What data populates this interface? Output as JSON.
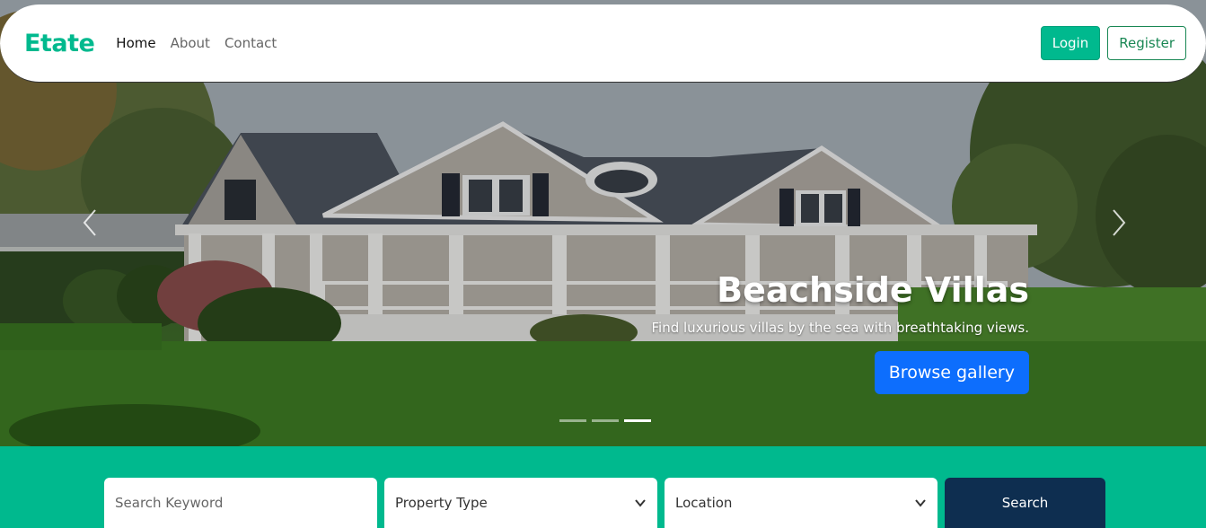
{
  "navbar": {
    "brand": "Etate",
    "links": [
      {
        "label": "Home",
        "active": true
      },
      {
        "label": "About",
        "active": false
      },
      {
        "label": "Contact",
        "active": false
      }
    ],
    "login_label": "Login",
    "register_label": "Register"
  },
  "hero": {
    "title": "Beachside Villas",
    "subtitle": "Find luxurious villas by the sea with breathtaking views.",
    "cta_label": "Browse gallery",
    "prev_icon": "chevron-left-icon",
    "next_icon": "chevron-right-icon",
    "slides_count": 3,
    "active_slide": 3
  },
  "search": {
    "keyword_placeholder": "Search Keyword",
    "property_type": "Property Type",
    "location": "Location",
    "button_label": "Search"
  },
  "colors": {
    "brand": "#00b98e",
    "primary_button": "#0d6efd",
    "search_button": "#0e2e50",
    "register_outline": "#198754"
  }
}
